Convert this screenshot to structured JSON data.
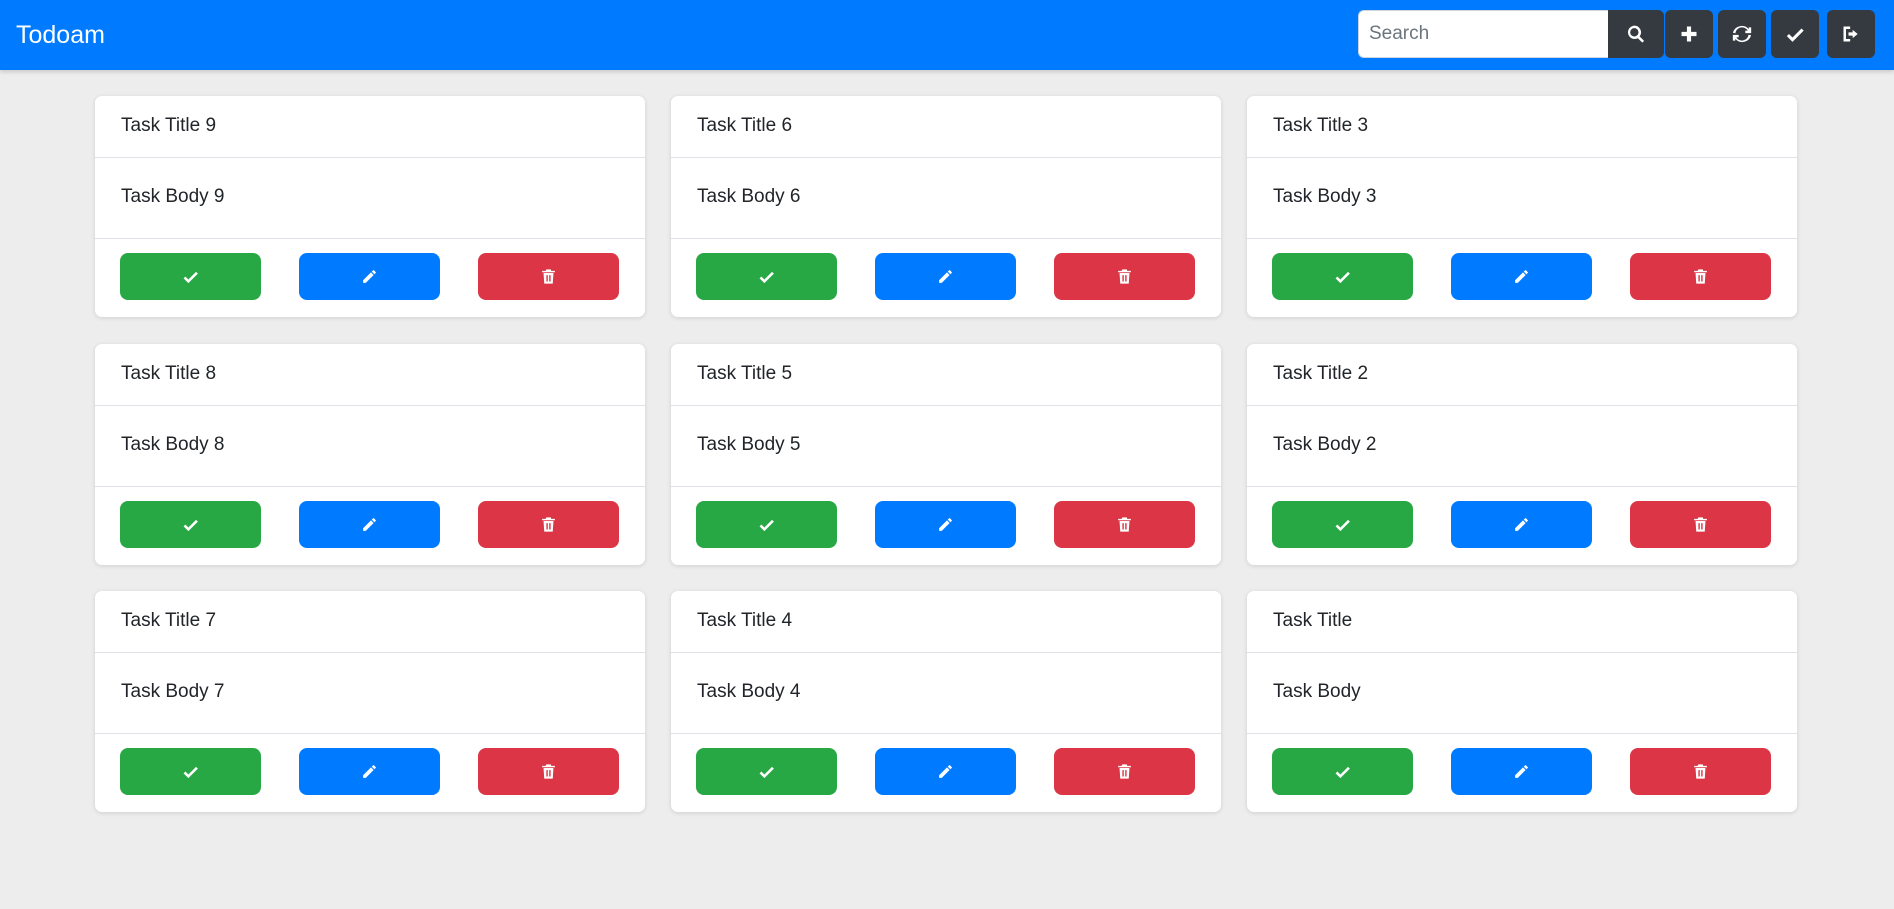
{
  "app": {
    "brand": "Todoam"
  },
  "navbar": {
    "search": {
      "placeholder": "Search"
    },
    "icons": [
      "search-icon",
      "plus-icon",
      "refresh-icon",
      "check-icon",
      "sign-out-icon"
    ]
  },
  "tasks": [
    {
      "title": "Task Title 9",
      "body": "Task Body 9"
    },
    {
      "title": "Task Title 6",
      "body": "Task Body 6"
    },
    {
      "title": "Task Title 3",
      "body": "Task Body 3"
    },
    {
      "title": "Task Title 8",
      "body": "Task Body 8"
    },
    {
      "title": "Task Title 5",
      "body": "Task Body 5"
    },
    {
      "title": "Task Title 2",
      "body": "Task Body 2"
    },
    {
      "title": "Task Title 7",
      "body": "Task Body 7"
    },
    {
      "title": "Task Title 4",
      "body": "Task Body 4"
    },
    {
      "title": "Task Title",
      "body": "Task Body"
    }
  ],
  "card_actions": {
    "icons": [
      "check-icon",
      "pencil-icon",
      "trash-icon"
    ]
  },
  "colors": {
    "primary": "#007bff",
    "success": "#28a745",
    "danger": "#dc3545",
    "dark": "#343a40",
    "background": "#ededed"
  }
}
